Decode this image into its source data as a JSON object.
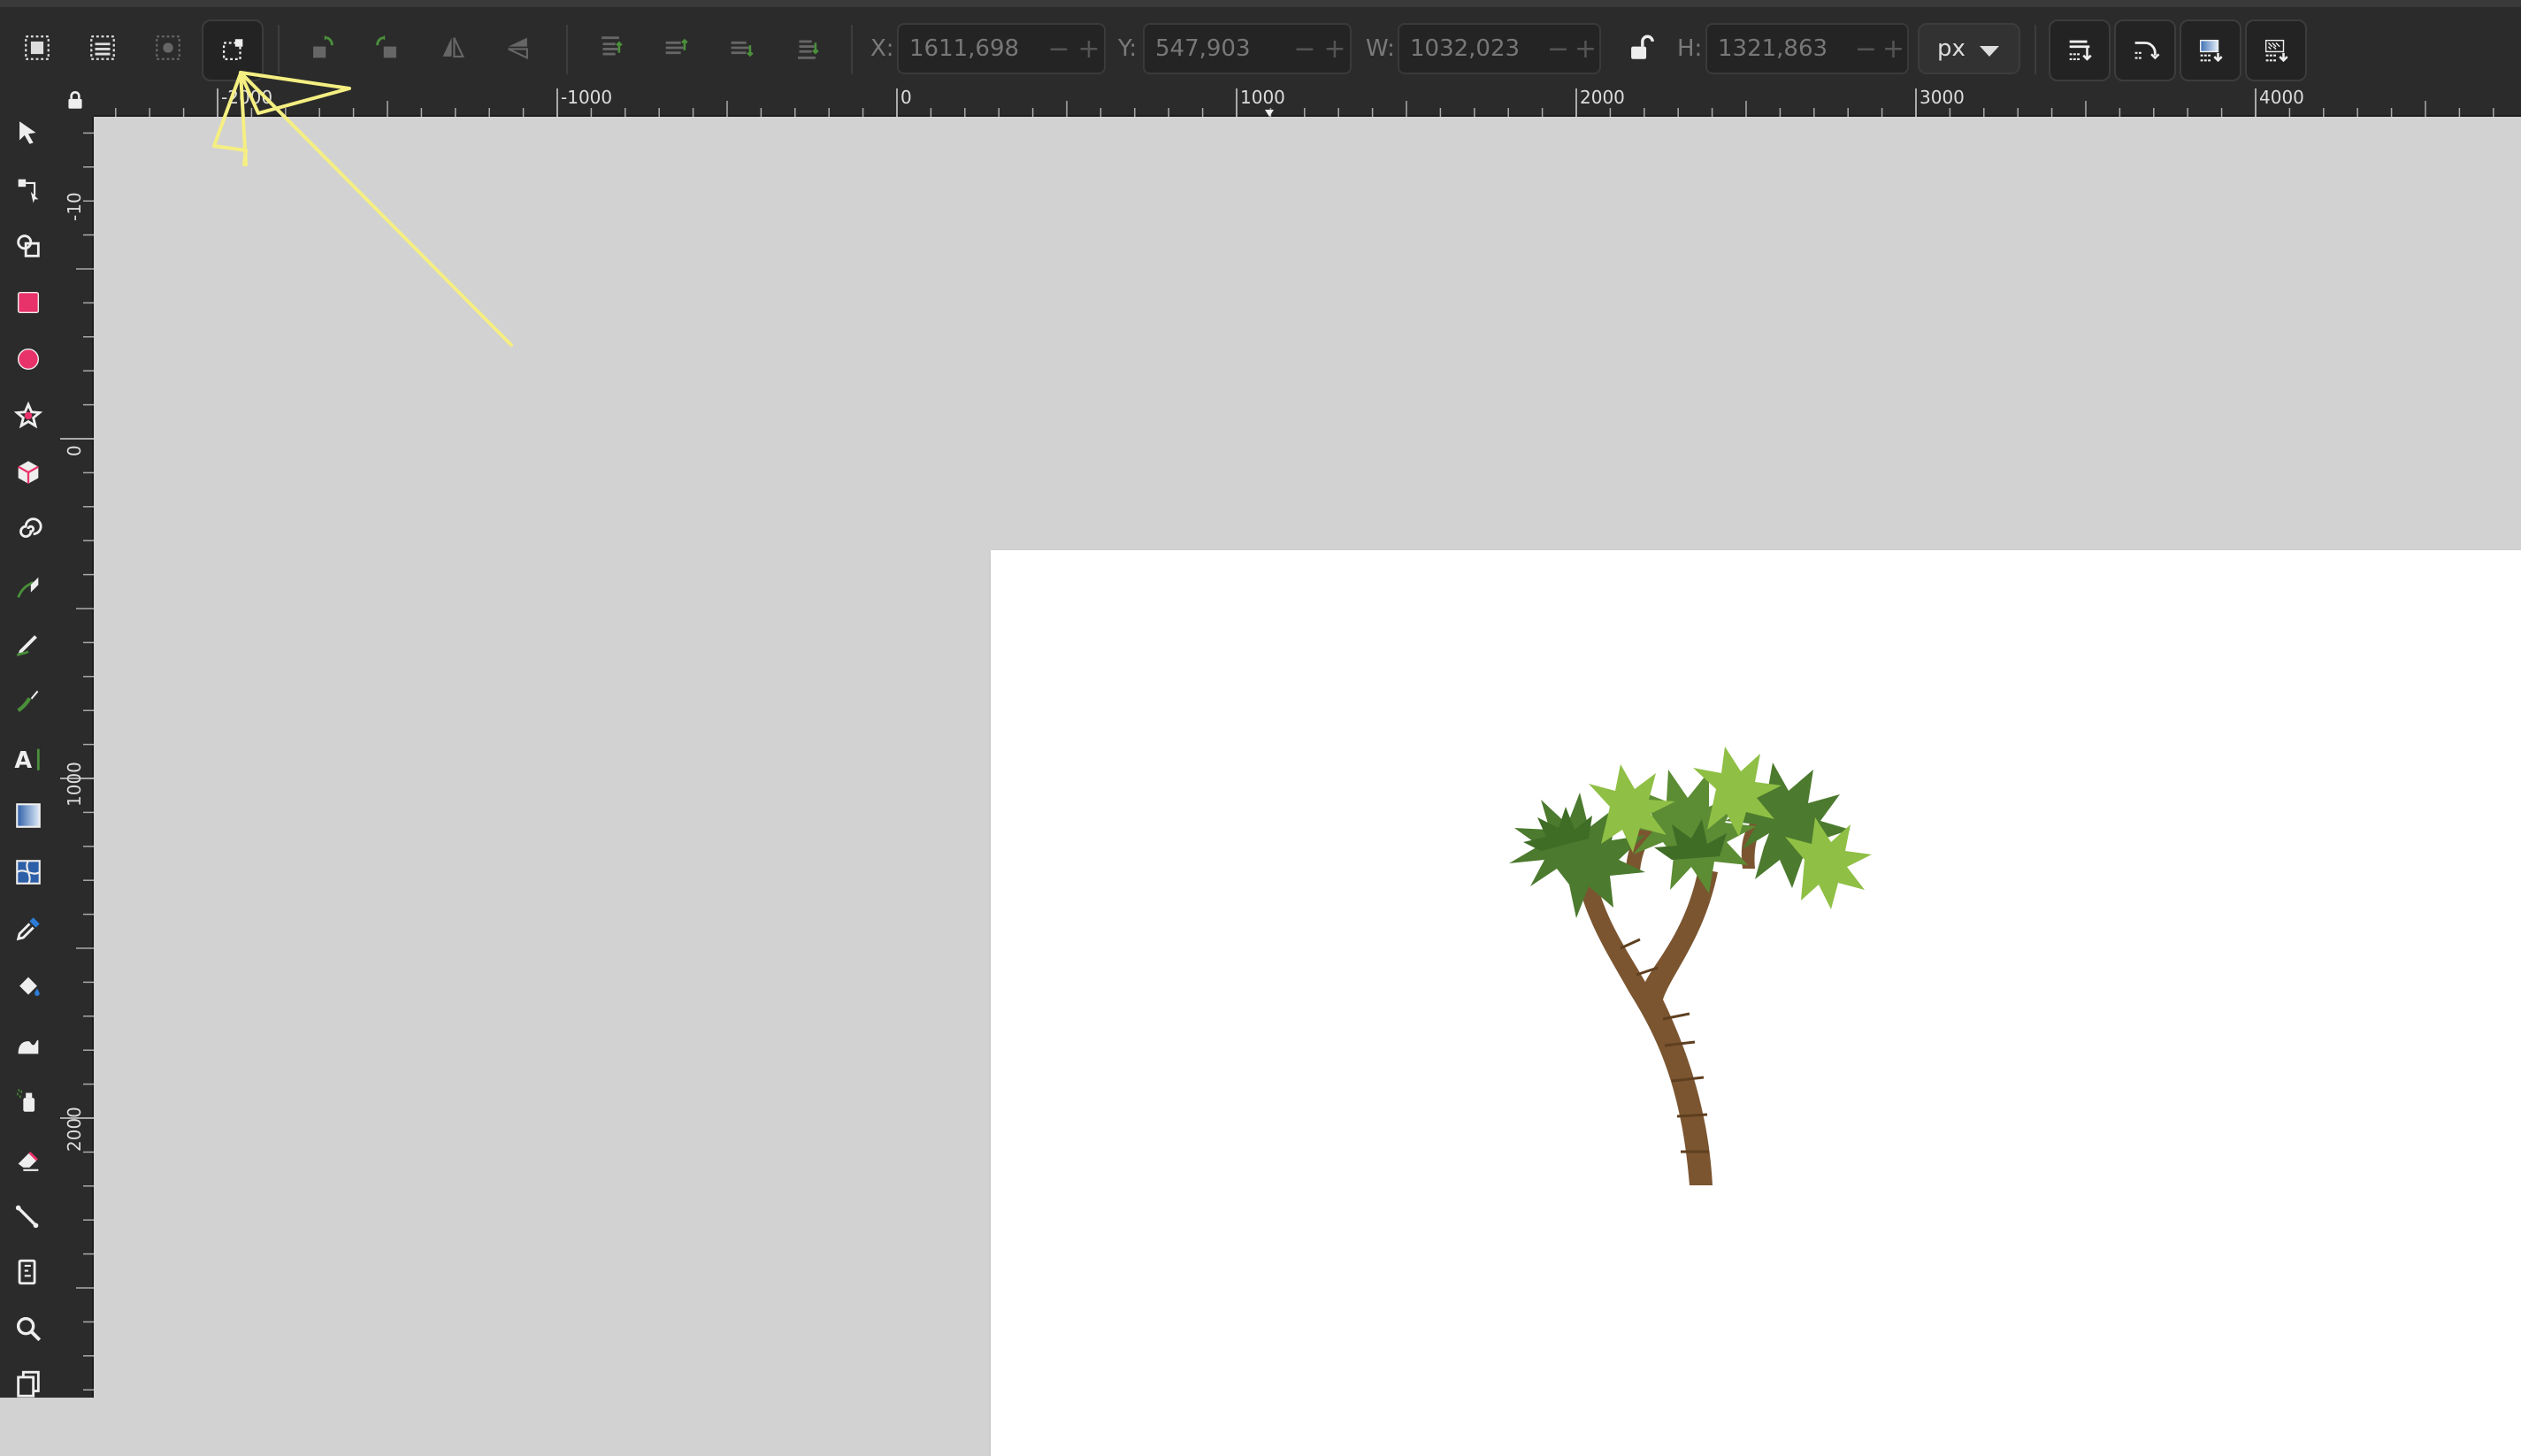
{
  "toolbar": {
    "x_label": "X:",
    "x_value": "1611,698",
    "y_label": "Y:",
    "y_value": "547,903",
    "w_label": "W:",
    "w_value": "1032,023",
    "h_label": "H:",
    "h_value": "1321,863",
    "unit": "px",
    "spin_minus": "−",
    "spin_plus": "+"
  },
  "rulers": {
    "horizontal_labels": [
      "-2000",
      "-1000",
      "0",
      "1000",
      "2000",
      "3000",
      "4000"
    ],
    "vertical_labels": [
      "-10",
      "0",
      "1000",
      "2000"
    ]
  },
  "colors": {
    "accent_yellow": "#f5ef82",
    "trunk": "#7b5530",
    "leaf_dark": "#4c7a2e",
    "leaf_light": "#8fbf45"
  },
  "icons": {
    "toolbox": [
      "selector-arrow-icon",
      "node-tool-icon",
      "shape-builder-icon",
      "rectangle-tool-icon",
      "ellipse-tool-icon",
      "star-tool-icon",
      "box-3d-tool-icon",
      "spiral-tool-icon",
      "pen-tool-icon",
      "pencil-tool-icon",
      "calligraphy-tool-icon",
      "text-tool-icon",
      "gradient-tool-icon",
      "mesh-tool-icon",
      "dropper-tool-icon",
      "paint-bucket-icon",
      "tweak-tool-icon",
      "spray-tool-icon",
      "eraser-tool-icon",
      "connector-tool-icon",
      "measure-tool-icon",
      "zoom-tool-icon",
      "pages-tool-icon"
    ]
  }
}
